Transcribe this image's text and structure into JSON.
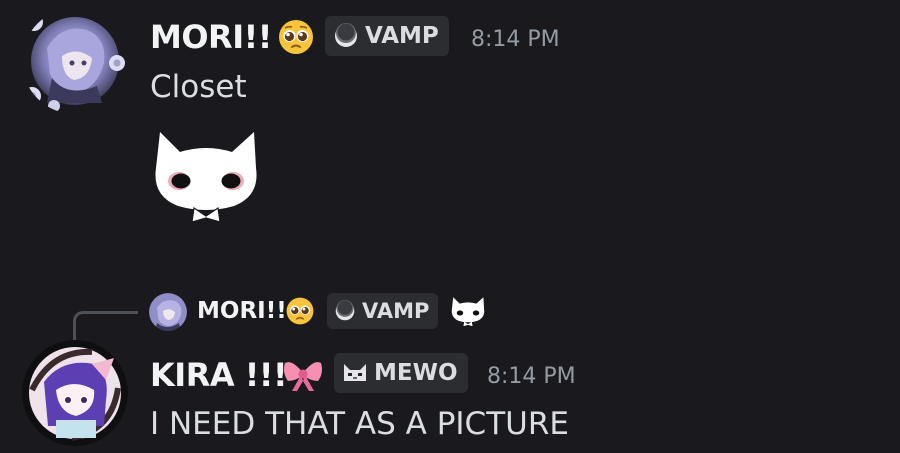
{
  "messages": [
    {
      "author": "MORI!!",
      "author_emoji": "pleading-face-emoji",
      "tag": {
        "label": "VAMP",
        "icon": "moon-icon"
      },
      "timestamp": "8:14 PM",
      "text": "Closet",
      "sticker": "white-cat-sticker"
    },
    {
      "author": "KIRA !!!",
      "author_emoji": "ribbon-emoji",
      "tag": {
        "label": "MEWO",
        "icon": "cat-face-icon"
      },
      "timestamp": "8:14 PM",
      "text": "I NEED THAT AS A PICTURE",
      "reply": {
        "author": "MORI!!",
        "author_emoji": "pleading-face-emoji",
        "tag": {
          "label": "VAMP",
          "icon": "moon-icon"
        },
        "attachment_icon": "white-cat-sticker-icon"
      }
    }
  ],
  "colors": {
    "background": "#1a1a1e",
    "username": "#f2f3f5",
    "text": "#dbdee1",
    "timestamp": "#949ba4",
    "tag_background": "#2b2d31"
  }
}
